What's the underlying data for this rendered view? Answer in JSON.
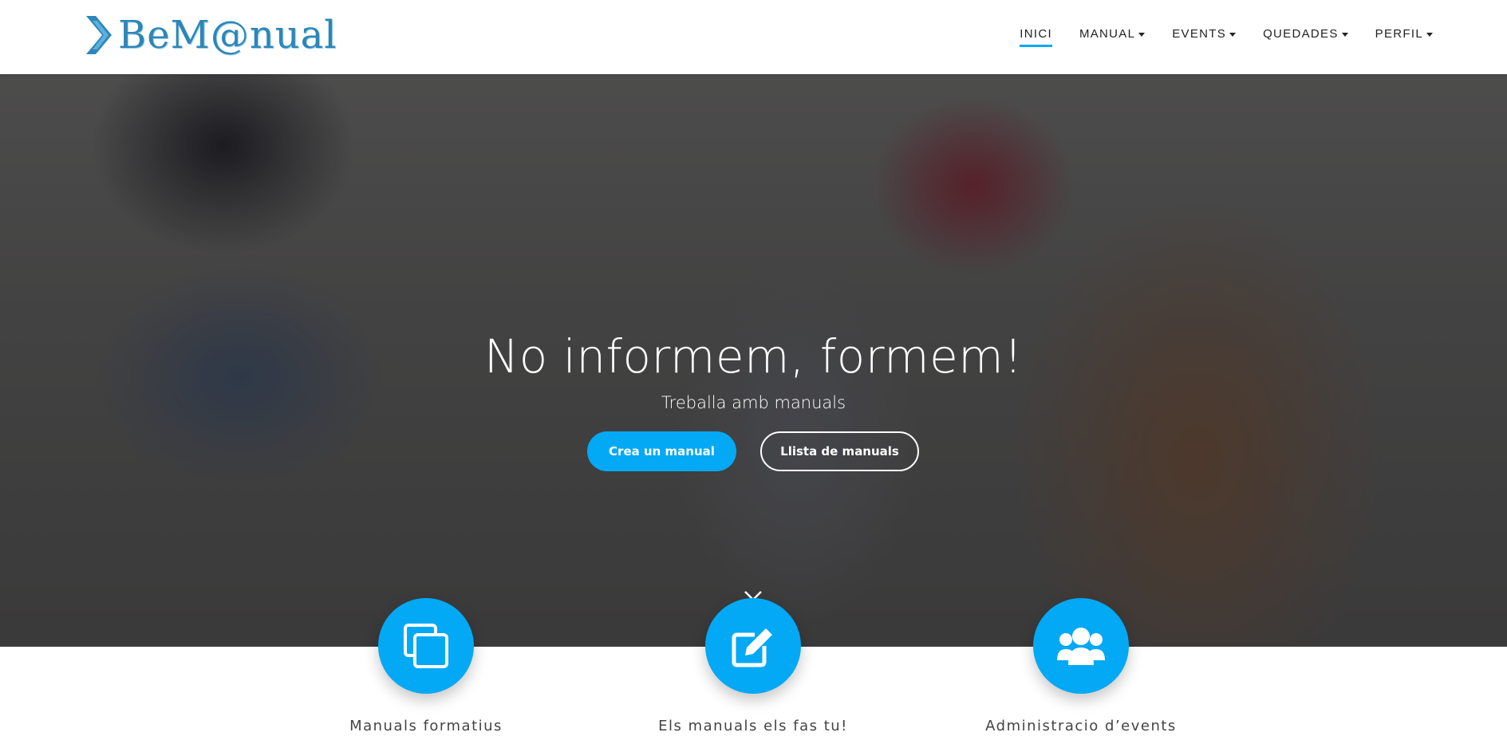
{
  "brand": {
    "logo_text": "BeM@nual"
  },
  "nav": {
    "items": [
      {
        "label": "INICI",
        "active": true,
        "dropdown": false
      },
      {
        "label": "MANUAL",
        "active": false,
        "dropdown": true
      },
      {
        "label": "EVENTS",
        "active": false,
        "dropdown": true
      },
      {
        "label": "QUEDADES",
        "active": false,
        "dropdown": true
      },
      {
        "label": "PERFIL",
        "active": false,
        "dropdown": true
      }
    ]
  },
  "hero": {
    "title": "No informem, formem!",
    "subtitle": "Treballa amb manuals",
    "primary_button": "Crea un manual",
    "secondary_button": "Llista de manuals"
  },
  "features": [
    {
      "label": "Manuals formatius",
      "icon": "copy-icon"
    },
    {
      "label": "Els manuals els fas tu!",
      "icon": "edit-icon"
    },
    {
      "label": "Administracio d’events",
      "icon": "users-icon"
    }
  ],
  "colors": {
    "accent": "#03a9f4",
    "nav_text": "#222222",
    "logo": "#2d86b8"
  }
}
